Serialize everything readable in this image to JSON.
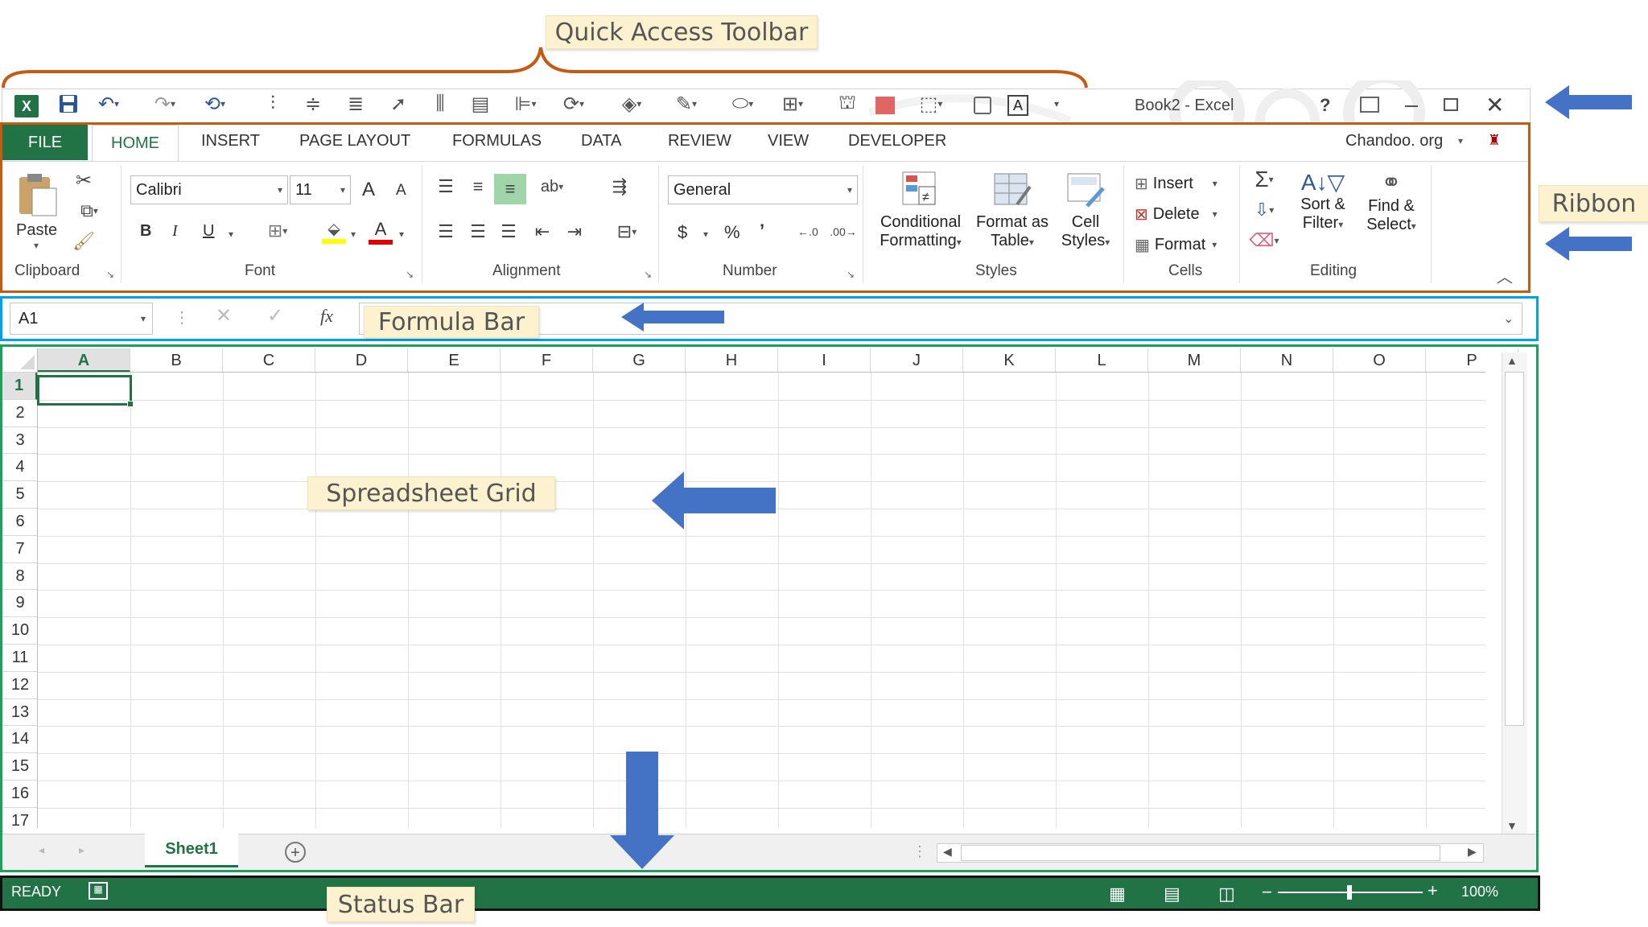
{
  "callouts": {
    "qat": "Quick Access Toolbar",
    "ribbon": "Ribbon",
    "formula_bar": "Formula Bar",
    "grid": "Spreadsheet Grid",
    "status_bar": "Status Bar"
  },
  "window": {
    "title": "Book2 - Excel",
    "help": "?"
  },
  "tabs": [
    "FILE",
    "HOME",
    "INSERT",
    "PAGE LAYOUT",
    "FORMULAS",
    "DATA",
    "REVIEW",
    "VIEW",
    "DEVELOPER"
  ],
  "account": "Chandoo. org",
  "ribbon": {
    "clipboard": {
      "paste": "Paste",
      "label": "Clipboard"
    },
    "font": {
      "name": "Calibri",
      "size": "11",
      "label": "Font",
      "bold": "B",
      "italic": "I",
      "underline": "U",
      "grow": "A",
      "shrink": "A",
      "color": "A"
    },
    "alignment": {
      "label": "Alignment"
    },
    "number": {
      "format": "General",
      "label": "Number",
      "currency": "$",
      "percent": "%",
      "comma": "’"
    },
    "styles": {
      "conditional_1": "Conditional",
      "conditional_2": "Formatting",
      "format_table_1": "Format as",
      "format_table_2": "Table",
      "cell_styles_1": "Cell",
      "cell_styles_2": "Styles",
      "label": "Styles"
    },
    "cells": {
      "insert": "Insert",
      "delete": "Delete",
      "format": "Format",
      "label": "Cells"
    },
    "editing": {
      "sort_1": "Sort &",
      "sort_2": "Filter",
      "find_1": "Find &",
      "find_2": "Select",
      "label": "Editing"
    }
  },
  "formula_bar": {
    "name_box": "A1",
    "fx": "fx",
    "value": ""
  },
  "grid": {
    "columns": [
      "A",
      "B",
      "C",
      "D",
      "E",
      "F",
      "G",
      "H",
      "I",
      "J",
      "K",
      "L",
      "M",
      "N",
      "O",
      "P"
    ],
    "rows": [
      "1",
      "2",
      "3",
      "4",
      "5",
      "6",
      "7",
      "8",
      "9",
      "10",
      "11",
      "12",
      "13",
      "14",
      "15",
      "16",
      "17"
    ],
    "selected": "A1"
  },
  "sheets": {
    "active": "Sheet1"
  },
  "status_bar": {
    "status": "READY",
    "zoom": "100%",
    "zoom_level": 0.5
  },
  "colors": {
    "excel_green": "#217346",
    "ribbon_border": "#c55a11",
    "formula_border": "#00a2e8",
    "grid_border": "#1aa15c",
    "arrow_blue": "#4472c4"
  }
}
